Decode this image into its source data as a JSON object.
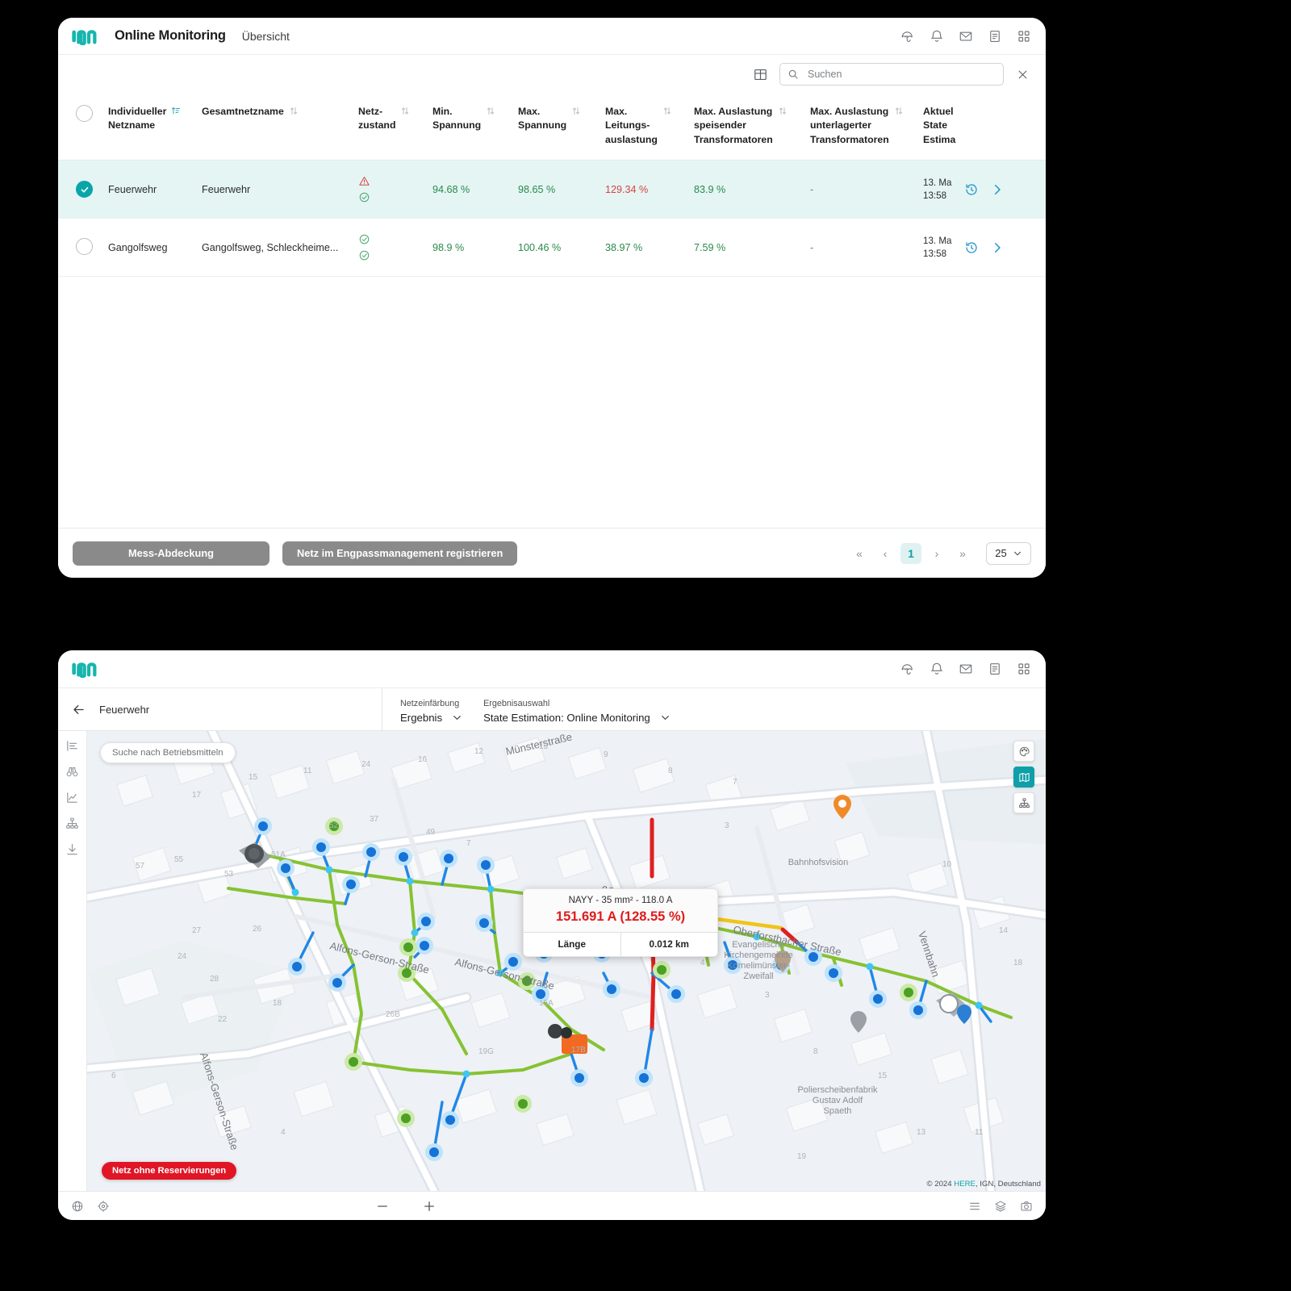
{
  "app": {
    "brand": "envelio",
    "title": "Online Monitoring",
    "subtitle": "Übersicht",
    "header_icons": [
      "umbrella-icon",
      "bell-icon",
      "mail-icon",
      "document-icon",
      "apps-grid-icon"
    ]
  },
  "toolbar": {
    "grid_icon": "table-layout-icon",
    "search_icon": "search-icon",
    "search_value": "",
    "search_placeholder": "Suchen",
    "clear_icon": "close-icon"
  },
  "table": {
    "columns": [
      {
        "label": "Individueller\nNetzname",
        "sort": "active"
      },
      {
        "label": "Gesamtnetzname",
        "sort": "both"
      },
      {
        "label": "Netz-\nzustand",
        "sort": "both"
      },
      {
        "label": "Min.\nSpannung",
        "sort": "both"
      },
      {
        "label": "Max.\nSpannung",
        "sort": "both"
      },
      {
        "label": "Max.\nLeitungs-\nauslastung",
        "sort": "both"
      },
      {
        "label": "Max. Auslastung\nspeisender\nTransformatoren",
        "sort": "both"
      },
      {
        "label": "Max. Auslastung\nunterlagerter\nTransformatoren",
        "sort": "both"
      },
      {
        "label": "Aktuel\nState\nEstima",
        "sort": "none"
      }
    ],
    "rows": [
      {
        "selected": true,
        "individueller_netzname": "Feuerwehr",
        "gesamtnetzname": "Feuerwehr",
        "netzzustand": [
          "warning",
          "ok"
        ],
        "min_spannung": "94.68 %",
        "max_spannung": "98.65 %",
        "max_leitungsauslastung": "129.34 %",
        "max_auslastung_speisender": "83.9 %",
        "max_auslastung_unterlagerter": "-",
        "aktuelle_state_estimation": "13. Ma\n13:58",
        "actions": [
          "history-icon",
          "chevron-right-icon"
        ]
      },
      {
        "selected": false,
        "individueller_netzname": "Gangolfsweg",
        "gesamtnetzname": "Gangolfsweg, Schleckheime...",
        "netzzustand": [
          "ok",
          "ok"
        ],
        "min_spannung": "98.9 %",
        "max_spannung": "100.46 %",
        "max_leitungsauslastung": "38.97 %",
        "max_auslastung_speisender": "7.59 %",
        "max_auslastung_unterlagerter": "-",
        "aktuelle_state_estimation": "13. Ma\n13:58",
        "actions": [
          "history-icon",
          "chevron-right-icon"
        ]
      }
    ]
  },
  "footer": {
    "btn_mess_abdeckung": "Mess-Abdeckung",
    "btn_engpass": "Netz im Engpassmanagement registrieren",
    "pager": {
      "first": "«",
      "prev": "‹",
      "current": "1",
      "next": "›",
      "last": "»",
      "page_size": "25"
    }
  },
  "map_window": {
    "header_icons": [
      "umbrella-icon",
      "bell-icon",
      "mail-icon",
      "document-icon",
      "apps-grid-icon"
    ],
    "back_icon": "arrow-left-icon",
    "network_name": "Feuerwehr",
    "netzeinfaerbung_label": "Netzeinfärbung",
    "netzeinfaerbung_value": "Ergebnis",
    "ergebnisauswahl_label": "Ergebnisauswahl",
    "ergebnisauswahl_value": "State Estimation: Online Monitoring",
    "rail_icons": [
      "bar-chart-icon",
      "binoculars-icon",
      "line-chart-icon",
      "topology-icon",
      "download-icon"
    ],
    "map_search_placeholder": "Suche nach Betriebsmitteln",
    "map_controls": [
      "palette-icon",
      "basemap-icon",
      "topology-layers-icon"
    ],
    "tooltip": {
      "title": "NAYY - 35 mm² - 118.0 A",
      "value": "151.691 A (128.55 %)",
      "row_label": "Länge",
      "row_value": "0.012 km"
    },
    "badge": "Netz ohne Reservierungen",
    "attribution_prefix": "© 2024 ",
    "attribution_link": "HERE",
    "attribution_suffix": ", IGN, Deutschland",
    "zoom_out": "−",
    "zoom_in": "+",
    "footer_left_icons": [
      "globe-icon",
      "crosshair-icon"
    ],
    "footer_right_icons": [
      "legend-list-icon",
      "layers-icon",
      "snapshot-icon"
    ],
    "street_labels": [
      "Münsterstraße",
      "Alfons-Gerson-Straße",
      "Alfons-Gerson-Straße",
      "Alfons-Gerson-Straße",
      "Oberforstbacher Straße",
      "Vennbahn",
      "Straße"
    ],
    "poi_labels": [
      "Bahnhofsvision",
      "Evangelische Kirchengemeinde Kornelimünster-Zweifall",
      "Polierscheibenfabrik Gustav Adolf Spaeth"
    ]
  },
  "colors": {
    "accent": "#0aa5a8",
    "selected_row": "#e4f5f4",
    "ok_green": "#2b8a4a",
    "warn_red": "#d7443e",
    "badge_red": "#e01627",
    "btn_grey": "#8a8a8a"
  }
}
